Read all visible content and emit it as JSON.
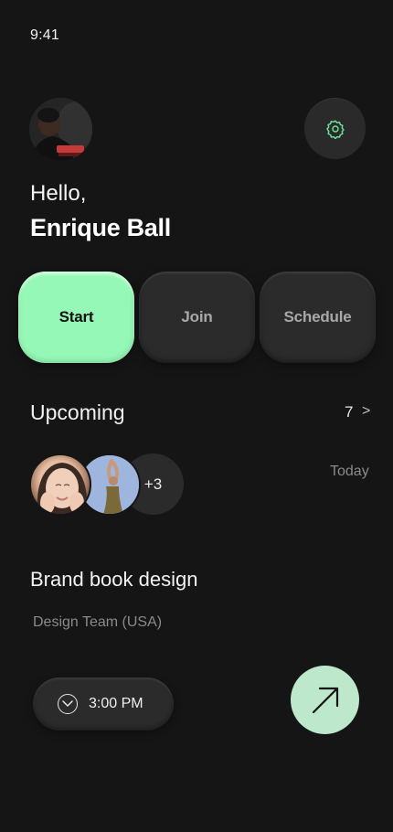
{
  "status_bar": {
    "time": "9:41"
  },
  "header": {
    "avatar": "profile-avatar",
    "settings_icon": "gear-icon",
    "greeting": "Hello,",
    "user_name": "Enrique Ball"
  },
  "actions": [
    {
      "label": "Start",
      "active": true
    },
    {
      "label": "Join",
      "active": false
    },
    {
      "label": "Schedule",
      "active": false
    }
  ],
  "upcoming": {
    "title": "Upcoming",
    "count": "7",
    "chevron": ">",
    "participants_more": "+3",
    "day": "Today",
    "event": {
      "title": "Brand book design",
      "team": "Design Team (USA)",
      "time": "3:00 PM"
    }
  },
  "colors": {
    "background": "#151515",
    "accent_green": "#95f8b6",
    "go_button": "#bde8cb",
    "card_dark": "#2b2b2b",
    "muted_text": "#8a8a8a"
  }
}
